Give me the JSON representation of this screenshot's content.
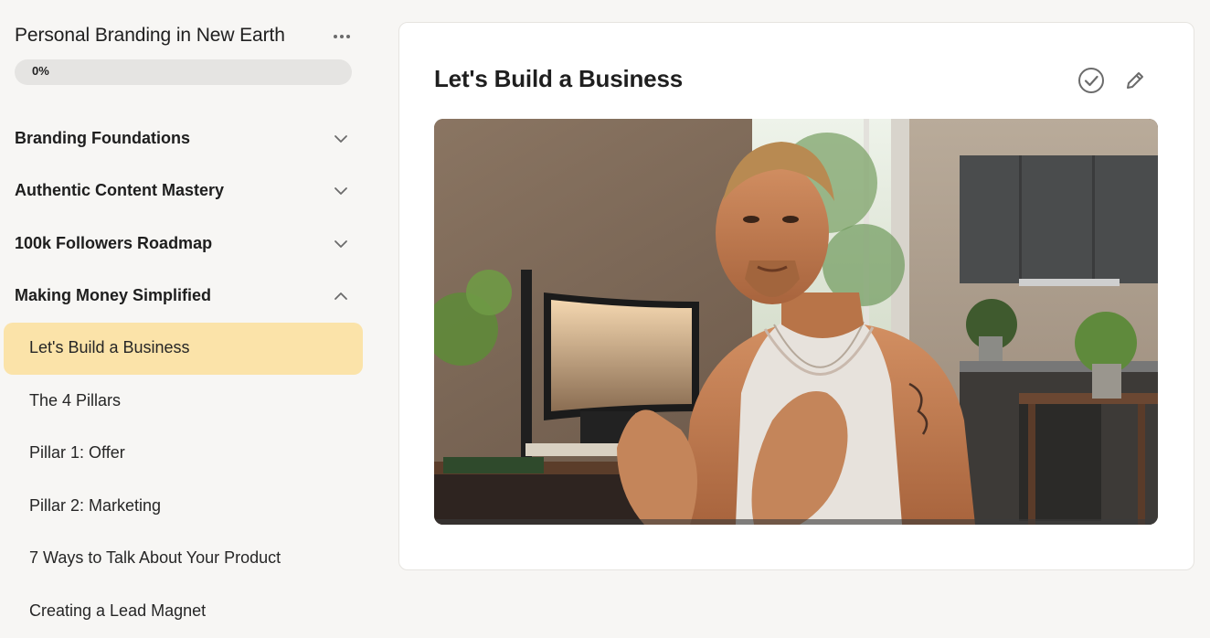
{
  "course": {
    "title": "Personal Branding in New Earth",
    "progress_label": "0%",
    "progress_fraction": 0
  },
  "modules": [
    {
      "label": "Branding Foundations",
      "expanded": false
    },
    {
      "label": "Authentic Content Mastery",
      "expanded": false
    },
    {
      "label": "100k Followers Roadmap",
      "expanded": false
    },
    {
      "label": "Making Money Simplified",
      "expanded": true
    }
  ],
  "lessons": [
    {
      "label": "Let's Build a Business",
      "active": true
    },
    {
      "label": "The 4 Pillars",
      "active": false
    },
    {
      "label": "Pillar 1: Offer",
      "active": false
    },
    {
      "label": "Pillar 2: Marketing",
      "active": false
    },
    {
      "label": "7 Ways to Talk About Your Product",
      "active": false
    },
    {
      "label": "Creating a Lead Magnet",
      "active": false
    }
  ],
  "lesson_view": {
    "title": "Let's Build a Business"
  },
  "colors": {
    "accent": "#fbe3a9",
    "background": "#f7f6f4",
    "card": "#ffffff",
    "icon": "#6b6b6b"
  }
}
